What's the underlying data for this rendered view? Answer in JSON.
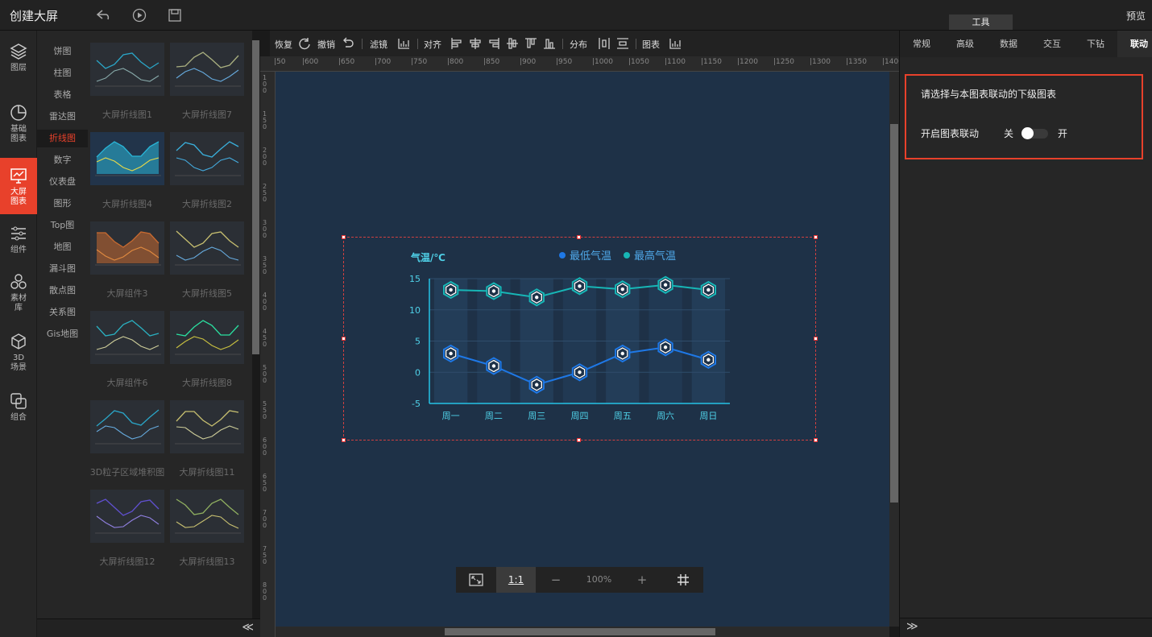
{
  "topbar": {
    "title": "创建大屏",
    "tool_tab": "工具",
    "preview": "预览"
  },
  "iconbar": [
    {
      "label": "图层",
      "icon": "layers-icon"
    },
    {
      "label": "基础\n图表",
      "icon": "pie-chart-icon"
    },
    {
      "label": "大屏\n图表",
      "icon": "screen-chart-icon",
      "active": true
    },
    {
      "label": "组件",
      "icon": "sliders-icon"
    },
    {
      "label": "素材\n库",
      "icon": "hexagons-icon"
    },
    {
      "label": "3D\n场景",
      "icon": "cube-icon"
    },
    {
      "label": "组合",
      "icon": "combine-icon"
    }
  ],
  "categories": [
    "饼图",
    "柱图",
    "表格",
    "雷达图",
    "折线图",
    "数字",
    "仪表盘",
    "图形",
    "Top图",
    "地图",
    "漏斗图",
    "散点图",
    "关系图",
    "Gis地图"
  ],
  "active_category": "折线图",
  "thumbnails": [
    "大屏折线图1",
    "大屏折线图7",
    "大屏折线图4",
    "大屏折线图2",
    "大屏组件3",
    "大屏折线图5",
    "大屏组件6",
    "大屏折线图8",
    "3D粒子区域堆积图",
    "大屏折线图11",
    "大屏折线图12",
    "大屏折线图13"
  ],
  "toolbar": {
    "redo": "恢复",
    "undo": "撤销",
    "filter": "滤镜",
    "align": "对齐",
    "distribute": "分布",
    "chart": "图表"
  },
  "ruler_labels": [
    "50",
    "600",
    "650",
    "700",
    "750",
    "800",
    "850",
    "900",
    "950",
    "1000",
    "1050",
    "1100",
    "1150",
    "1200",
    "1250",
    "1300",
    "1350",
    "1400"
  ],
  "ruler_left_labels": [
    "100",
    "150",
    "200",
    "250",
    "300",
    "350",
    "400",
    "450",
    "500",
    "550",
    "600",
    "650",
    "700",
    "750",
    "800"
  ],
  "zoom": {
    "fit_icon": "fit-screen-icon",
    "one_to_one": "1:1",
    "minus": "−",
    "value": "100%",
    "plus": "+",
    "grid_icon": "grid-icon"
  },
  "right_tabs": [
    "常规",
    "高级",
    "数据",
    "交互",
    "下钻",
    "联动"
  ],
  "active_right_tab": "联动",
  "linkage": {
    "title": "请选择与本图表联动的下级图表",
    "label": "开启图表联动",
    "off": "关",
    "on": "开",
    "enabled": false
  },
  "chart_data": {
    "type": "line",
    "ylabel": "气温/℃",
    "categories": [
      "周一",
      "周二",
      "周三",
      "周四",
      "周五",
      "周六",
      "周日"
    ],
    "ylim": [
      -5,
      15
    ],
    "yticks": [
      15,
      10,
      5,
      0,
      -5
    ],
    "series": [
      {
        "name": "最低气温",
        "values": [
          3,
          1,
          -2,
          0,
          3,
          4,
          2
        ],
        "color": "#1e78e6"
      },
      {
        "name": "最高气温",
        "values": [
          13.2,
          13,
          12,
          13.8,
          13.3,
          14,
          13.2
        ],
        "color": "#17b6b6"
      }
    ],
    "legend": "top-right",
    "colors": {
      "axis": "#25c2e6",
      "tick_text": "#4fd1e8"
    }
  }
}
